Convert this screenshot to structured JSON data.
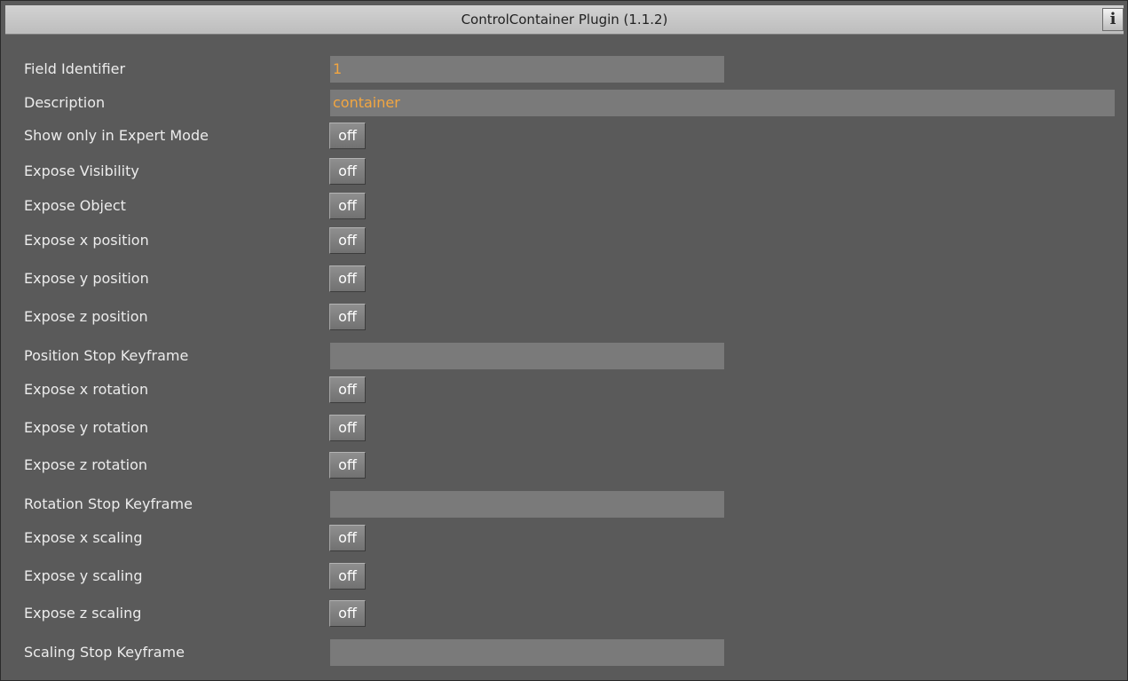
{
  "window": {
    "title": "ControlContainer Plugin (1.1.2)",
    "info_label": "i"
  },
  "rows": [
    {
      "label": "Field Identifier",
      "type": "text",
      "value": "1"
    },
    {
      "label": "Description",
      "type": "text",
      "value": "container"
    },
    {
      "label": "Show only in Expert Mode",
      "type": "toggle",
      "value": "off"
    },
    {
      "label": "Expose Visibility",
      "type": "toggle",
      "value": "off"
    },
    {
      "label": "Expose Object",
      "type": "toggle",
      "value": "off"
    },
    {
      "label": "Expose x position",
      "type": "toggle",
      "value": "off"
    },
    {
      "label": "Expose y position",
      "type": "toggle",
      "value": "off"
    },
    {
      "label": "Expose z position",
      "type": "toggle",
      "value": "off"
    },
    {
      "label": "Position Stop Keyframe",
      "type": "text",
      "value": ""
    },
    {
      "label": "Expose x rotation",
      "type": "toggle",
      "value": "off"
    },
    {
      "label": "Expose y rotation",
      "type": "toggle",
      "value": "off"
    },
    {
      "label": "Expose z rotation",
      "type": "toggle",
      "value": "off"
    },
    {
      "label": "Rotation Stop Keyframe",
      "type": "text",
      "value": ""
    },
    {
      "label": "Expose x scaling",
      "type": "toggle",
      "value": "off"
    },
    {
      "label": "Expose y scaling",
      "type": "toggle",
      "value": "off"
    },
    {
      "label": "Expose z scaling",
      "type": "toggle",
      "value": "off"
    },
    {
      "label": "Scaling Stop Keyframe",
      "type": "text",
      "value": ""
    }
  ],
  "colors": {
    "panel_background": "#5a5a5a",
    "field_background": "#7a7a7a",
    "field_text": "#f3a640",
    "label_text": "#ececec"
  }
}
